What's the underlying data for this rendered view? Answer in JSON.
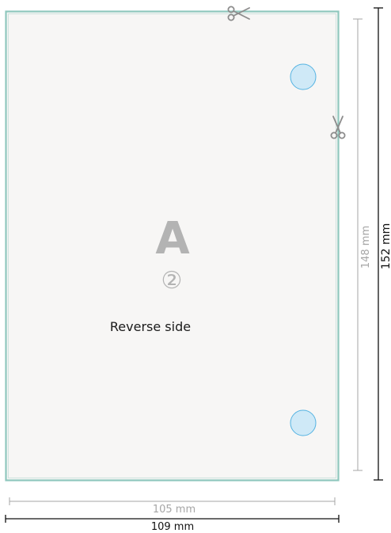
{
  "card": {
    "letter": "A",
    "side_number": "②",
    "side_label": "Reverse side"
  },
  "dimensions": {
    "inner_width": "105 mm",
    "outer_width": "109 mm",
    "inner_height": "148 mm",
    "outer_height": "152 mm"
  },
  "icons": {
    "scissors_top": "scissors-icon",
    "scissors_right": "scissors-icon",
    "hole_top": "punch-hole",
    "hole_bottom": "punch-hole"
  },
  "colors": {
    "page_background": "#ffffff",
    "card_fill": "#f7f6f5",
    "card_border": "#8fc7bd",
    "card_inner_border": "#cfe3de",
    "hole_fill": "#cfe9f7",
    "hole_stroke": "#55b3e2",
    "letter": "#b3b3b3",
    "side_number": "#b3b3b3",
    "side_label": "#1a1a1a",
    "inner_dim": "#a6a6a6",
    "outer_dim": "#111111",
    "scissors": "#8c8c8c"
  }
}
